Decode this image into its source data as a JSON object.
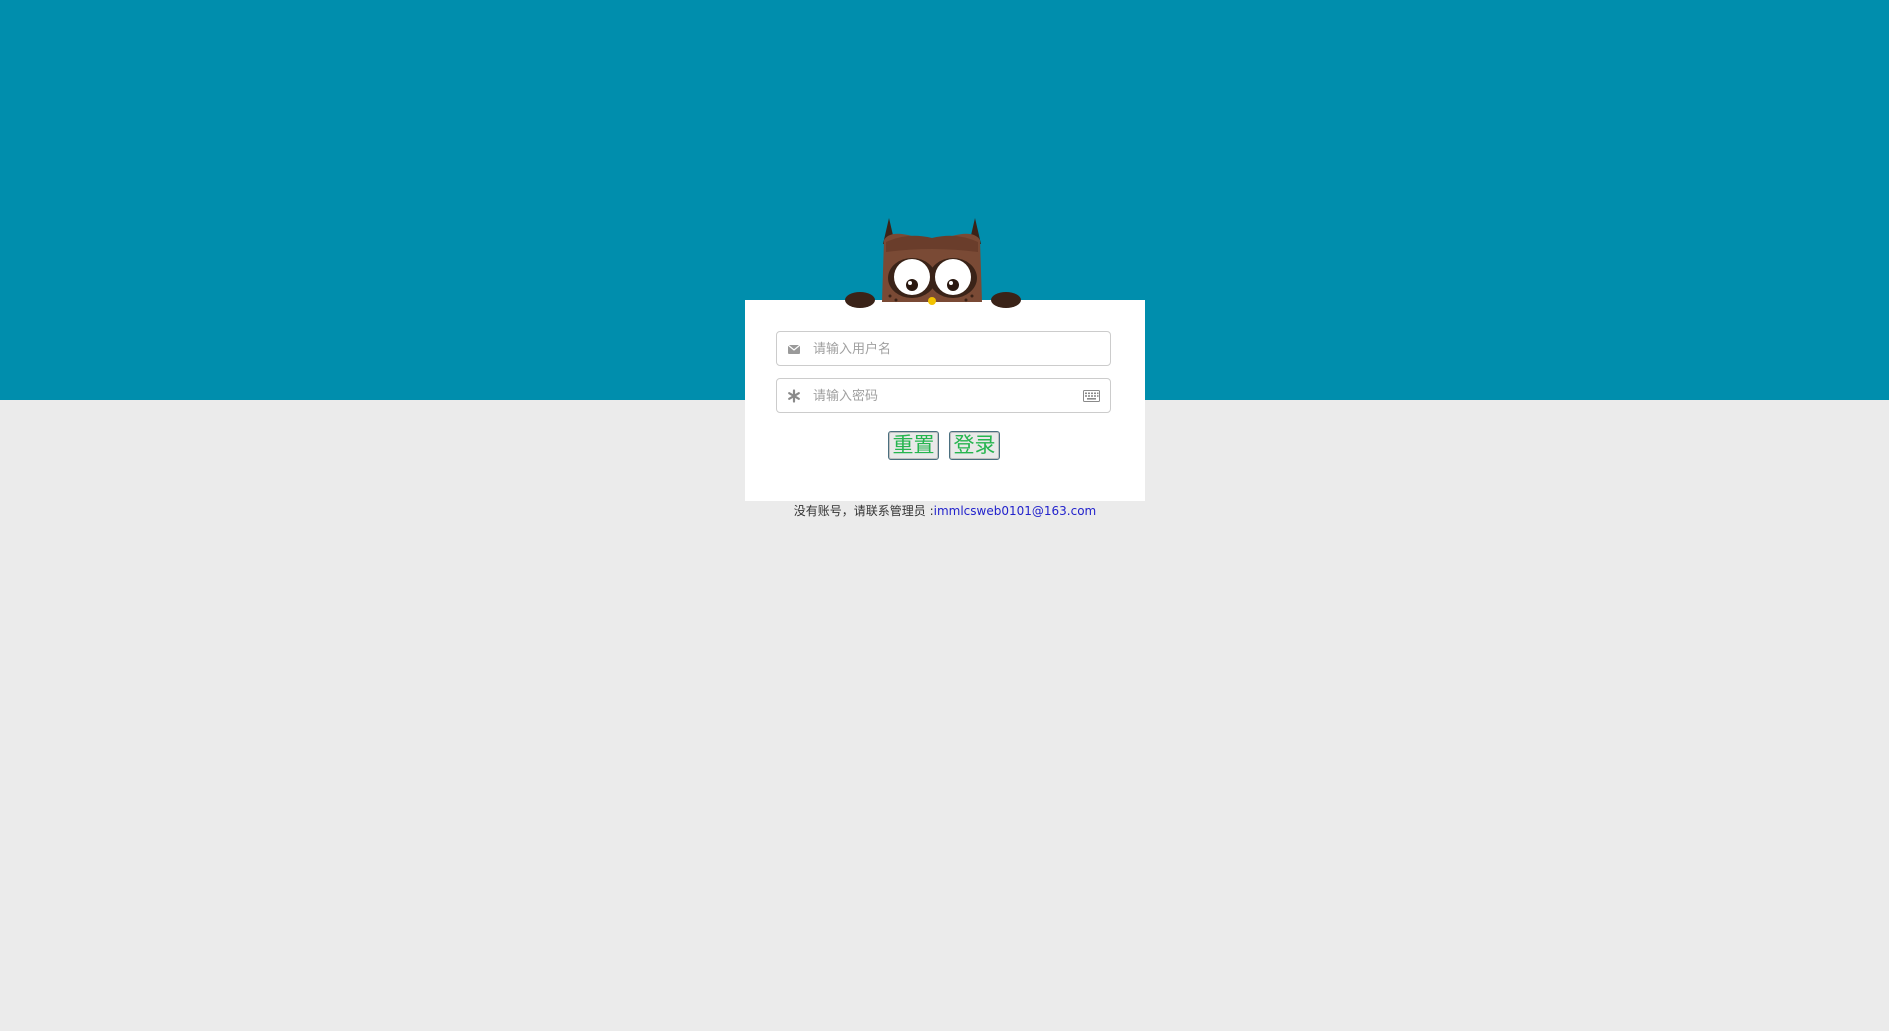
{
  "login_form": {
    "username_placeholder": "请输入用户名",
    "password_placeholder": "请输入密码",
    "reset_label": "重置",
    "login_label": "登录"
  },
  "footer": {
    "note_prefix": "没有账号，请联系管理员 :",
    "admin_email": "immlcsweb0101@163.com"
  },
  "icons": {
    "username": "envelope-icon",
    "password": "asterisk-icon",
    "keyboard": "keyboard-icon",
    "mascot": "owl-mascot"
  },
  "colors": {
    "top_band": "#008ead",
    "page_background": "#ebebeb",
    "card": "#ffffff",
    "button_text": "#26b54f",
    "email_link": "#2222cc"
  }
}
